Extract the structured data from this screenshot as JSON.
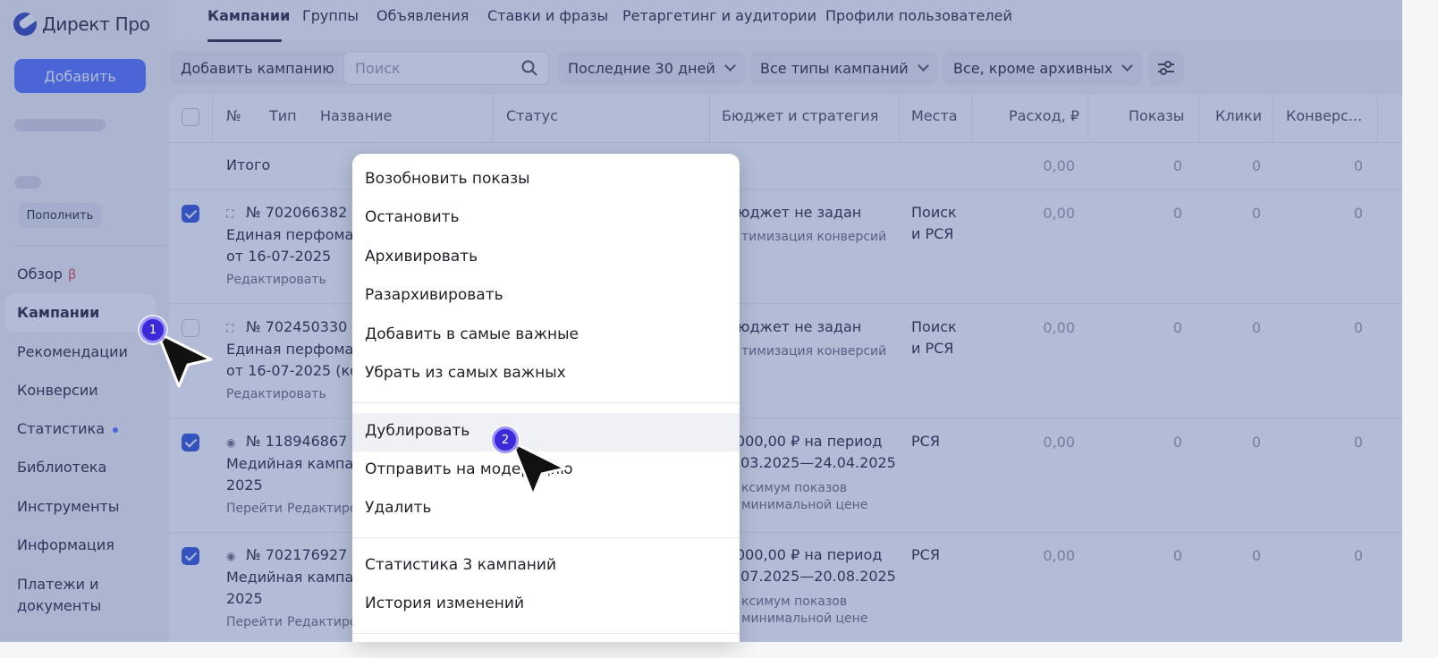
{
  "app": {
    "logo_text": "Директ Про"
  },
  "sidebar": {
    "add_label": "Добавить",
    "topup_label": "Пополнить",
    "items": [
      {
        "label": "Обзор",
        "badge": "β"
      },
      {
        "label": "Кампании"
      },
      {
        "label": "Рекомендации"
      },
      {
        "label": "Конверсии"
      },
      {
        "label": "Статистика"
      },
      {
        "label": "Библиотека"
      },
      {
        "label": "Инструменты"
      },
      {
        "label": "Информация"
      },
      {
        "label": "Платежи и",
        "label2": "документы"
      }
    ]
  },
  "tabs": [
    "Кампании",
    "Группы",
    "Объявления",
    "Ставки и фразы",
    "Ретаргетинг и аудитории",
    "Профили пользователей"
  ],
  "toolbar": {
    "add_campaign": "Добавить кампанию",
    "search_placeholder": "Поиск",
    "period": "Последние 30 дней",
    "types": "Все типы кампаний",
    "archive": "Все, кроме архивных"
  },
  "table": {
    "headers": {
      "num": "№",
      "type": "Тип",
      "name": "Название",
      "status": "Статус",
      "budget": "Бюджет и стратегия",
      "places": "Места",
      "spend": "Расход, ₽",
      "shows": "Показы",
      "clicks": "Клики",
      "conv": "Конверс..."
    },
    "total": {
      "label": "Итого",
      "spend": "0,00",
      "shows": "0",
      "clicks": "0",
      "conv": "0"
    },
    "rows": [
      {
        "id": "№ 702066382",
        "name1": "Единая перфоман",
        "name2": "от 16-07-2025",
        "link1": "Редактировать",
        "link2": "",
        "budget1": "юджет не задан",
        "budget2": "тимизация конверсий",
        "budget3": "",
        "budget4": "",
        "places1": "Поиск",
        "places2": "и РСЯ",
        "spend": "0,00",
        "shows": "0",
        "clicks": "0",
        "conv": "0"
      },
      {
        "id": "№ 702450330",
        "name1": "Единая перфоман",
        "name2": "от 16-07-2025 (ко",
        "link1": "Редактировать",
        "link2": "",
        "budget1": "юджет не задан",
        "budget2": "тимизация конверсий",
        "budget3": "",
        "budget4": "",
        "places1": "Поиск",
        "places2": "и РСЯ",
        "spend": "0,00",
        "shows": "0",
        "clicks": "0",
        "conv": "0"
      },
      {
        "id": "№ 118946867",
        "name1": "Медийная кампан",
        "name2": "2025",
        "link1": "Перейти",
        "link2": "Редактиро",
        "budget1": "000,00 ₽ на период",
        "budget2": ".03.2025—24.04.2025",
        "budget3": "ксимум показов",
        "budget4": "минимальной цене",
        "places1": "РСЯ",
        "places2": "",
        "spend": "0,00",
        "shows": "0",
        "clicks": "0",
        "conv": "0"
      },
      {
        "id": "№ 702176927",
        "name1": "Медийная кампан",
        "name2": "2025",
        "link1": "Перейти",
        "link2": "Редактиро",
        "budget1": "000,00 ₽ на период",
        "budget2": ".07.2025—20.08.2025",
        "budget3": "ксимум показов",
        "budget4": "минимальной цене",
        "places1": "РСЯ",
        "places2": "",
        "spend": "0,00",
        "shows": "0",
        "clicks": "0",
        "conv": "0"
      }
    ]
  },
  "menu": {
    "items": [
      "Возобновить показы",
      "Остановить",
      "Архивировать",
      "Разархивировать",
      "Добавить в самые важные",
      "Убрать из самых важных",
      "Дублировать",
      "Отправить на модерацию",
      "Удалить",
      "Статистика 3 кампаний",
      "История изменений"
    ]
  },
  "cursors": {
    "badge1": "1",
    "badge2": "2"
  },
  "colors": {
    "accent": "#5b79ff",
    "checkbox": "#3b5bdb",
    "overlay": "#2d468c"
  }
}
